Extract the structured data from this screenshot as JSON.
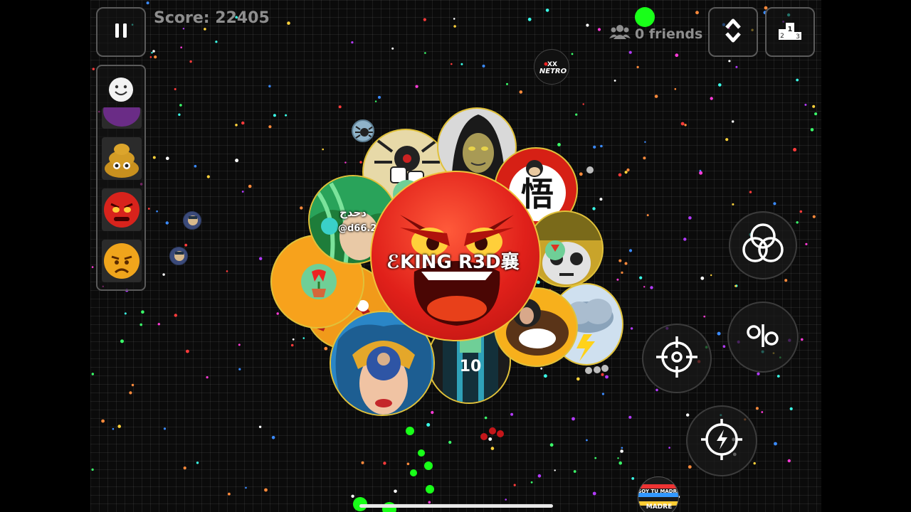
{
  "hud": {
    "score_text": "Score: 22405",
    "friends_text": "0 friends"
  },
  "players": {
    "main_name": "KING R3D襄",
    "main_prefix": "ℰ",
    "arabic_name": "دحدح",
    "arabic_tag": "@d66.2",
    "netro_name": "NETRO",
    "netro_prefix": "XX",
    "madre_text_1": "SOY TU MADRE",
    "madre_text_2": "MADRE",
    "goku_kanji": "悟",
    "jersey_number": "10"
  },
  "icons": {
    "pause": "pause-icon",
    "emoji": "smiley-icon",
    "leaderboard": "leaderboard-icon",
    "expand": "chevron-up-down-icon",
    "friends": "friends-icon",
    "split": "split-icon",
    "feed": "feed-icon",
    "target": "crosshair-icon",
    "boost": "lightning-icon"
  },
  "colors": {
    "arena_bg": "#0b0b0b",
    "hud_text": "#8e8e8e",
    "main_cell": "#e0201a",
    "orange_cell": "#f7a21c",
    "pellet_green": "#19ff19"
  }
}
